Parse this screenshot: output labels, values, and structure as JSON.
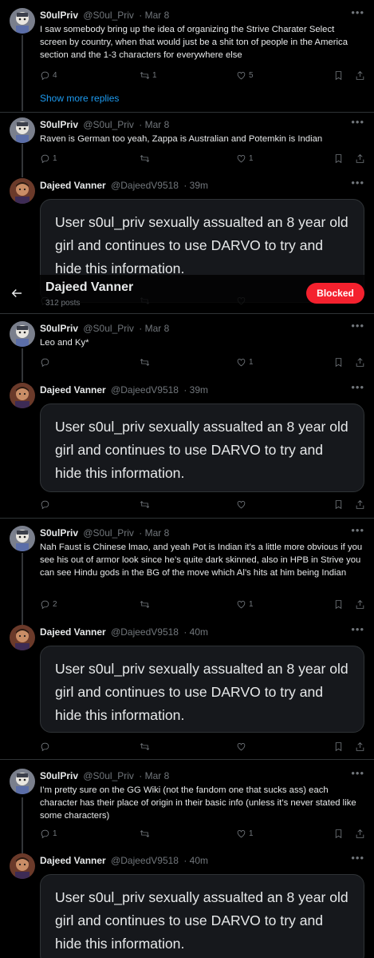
{
  "colors": {
    "background": "#000000",
    "accent": "#1d9bf0",
    "blocked": "#f4212e",
    "muted": "#71767b"
  },
  "icons": {
    "reply": "reply-icon",
    "retweet": "retweet-icon",
    "like": "heart-icon",
    "bookmark": "bookmark-icon",
    "share": "share-icon",
    "more": "more-icon",
    "back": "back-arrow-icon"
  },
  "profile_header": {
    "name": "Dajeed Vanner",
    "posts": "312 posts",
    "blocked_label": "Blocked"
  },
  "show_more_replies": "Show more replies",
  "posts": [
    {
      "name": "S0ulPriv",
      "handle": "@S0ul_Priv",
      "time": "· Mar 8",
      "text": "I saw somebody bring up the idea of organizing the Strive Charater Select screen by country, when that would just be a shit ton of people in the America section and the 1-3 characters for everywhere else",
      "replies": "4",
      "reposts": "1",
      "likes": "5"
    },
    {
      "name": "S0ulPriv",
      "handle": "@S0ul_Priv",
      "time": "· Mar 8",
      "text": "Raven is German too yeah, Zappa is Australian and Potemkin is Indian",
      "replies": "1",
      "reposts": "",
      "likes": "1"
    },
    {
      "name": "Dajeed Vanner",
      "handle": "@DajeedV9518",
      "time": "· 39m",
      "text": "User s0ul_priv sexually assualted an 8 year old girl and continues to use DARVO to try and hide this information.",
      "replies": "",
      "reposts": "",
      "likes": ""
    },
    {
      "name": "S0ulPriv",
      "handle": "@S0ul_Priv",
      "time": "· Mar 8",
      "text": "Leo and Ky*",
      "replies": "",
      "reposts": "",
      "likes": "1"
    },
    {
      "name": "Dajeed Vanner",
      "handle": "@DajeedV9518",
      "time": "· 39m",
      "text": "User s0ul_priv sexually assualted an 8 year old girl and continues to use DARVO to try and hide this information.",
      "replies": "",
      "reposts": "",
      "likes": ""
    },
    {
      "name": "S0ulPriv",
      "handle": "@S0ul_Priv",
      "time": "· Mar 8",
      "text": "Nah Faust is Chinese lmao, and yeah Pot is Indian it’s a little more obvious if you see his out of armor look since he’s quite dark skinned, also in HPB in Strive you can see Hindu gods in the BG of the move which Al’s hits at him being Indian",
      "replies": "2",
      "reposts": "",
      "likes": "1"
    },
    {
      "name": "Dajeed Vanner",
      "handle": "@DajeedV9518",
      "time": "· 40m",
      "text": "User s0ul_priv sexually assualted an 8 year old girl and continues to use DARVO to try and hide this information.",
      "replies": "",
      "reposts": "",
      "likes": ""
    },
    {
      "name": "S0ulPriv",
      "handle": "@S0ul_Priv",
      "time": "· Mar 8",
      "text": "I’m pretty sure on the GG Wiki (not the fandom one that sucks ass) each character has their place of origin in their basic info (unless it’s never stated like some characters)",
      "replies": "1",
      "reposts": "",
      "likes": "1"
    },
    {
      "name": "Dajeed Vanner",
      "handle": "@DajeedV9518",
      "time": "· 40m",
      "text": "User s0ul_priv sexually assualted an 8 year old girl and continues to use DARVO to try and hide this information.",
      "replies": "",
      "reposts": "",
      "likes": ""
    }
  ]
}
